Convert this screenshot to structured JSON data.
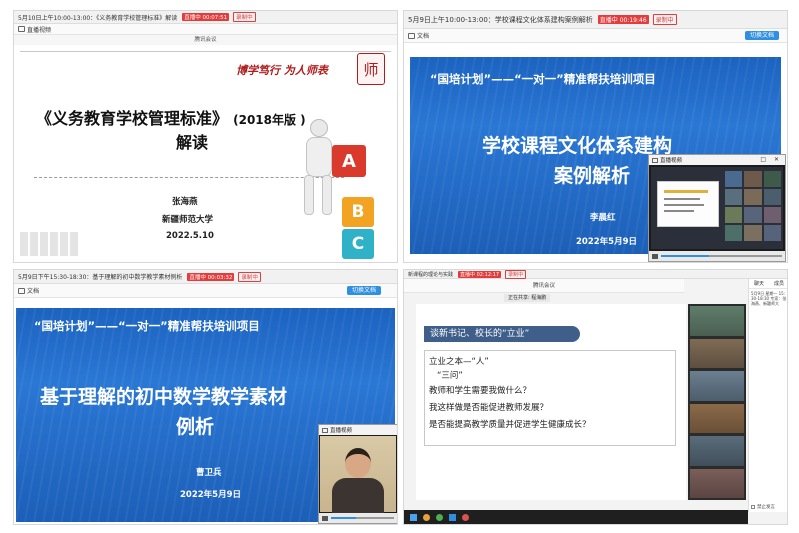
{
  "panel_tl": {
    "title": "5月10日上午10:00-13:00：《义务教育学校管理标准》解读",
    "badge_live": "直播中 00:07:51",
    "badge_rec": "录制中",
    "tab_label": "直播视频",
    "share_label": "腾讯会议",
    "motto": "博学笃行  为人师表",
    "heading": "《义务教育学校管理标准》",
    "heading_year": "(2018年版 )",
    "heading_sub": "解读",
    "speaker": "张海燕",
    "org": "新疆师范大学",
    "date": "2022.5.10",
    "cubes": [
      "A",
      "B",
      "C"
    ]
  },
  "panel_tr": {
    "title": "5月9日上午10:00-13:00：学校课程文化体系建构案例解析",
    "badge_live": "直播中 00:19:46",
    "badge_rec": "录制中",
    "doc_label": "文档",
    "switch_label": "切换文档",
    "program": "“国培计划”——“一对一”精准帮扶培训项目",
    "heading_line1": "学校课程文化体系建构",
    "heading_line2": "案例解析",
    "speaker": "李晨红",
    "date": "2022年5月9日",
    "video_label": "直播视频"
  },
  "panel_bl": {
    "title": "5月9日下午15:30-18:30：基于理解的初中数学教学素材例析",
    "badge_live": "直播中 00:03:32",
    "badge_rec": "录制中",
    "doc_label": "文档",
    "switch_label": "切换文档",
    "program": "“国培计划”——“一对一”精准帮扶培训项目",
    "heading_line1": "基于理解的初中数学教学素材",
    "heading_line2": "例析",
    "speaker": "曹卫兵",
    "date": "2022年5月9日",
    "video_label": "直播视频"
  },
  "panel_br": {
    "title": "新课程的理论与实践",
    "badge_live": "直播中 02:12:17",
    "badge_rec": "录制中",
    "share_label": "腾讯会议",
    "share_user": "正在共享: 程海鹏",
    "banner": "谈新书记、校长的“立业”",
    "lines": [
      "立业之本—“人”",
      "“三问”",
      "教师和学生需要我做什么？",
      "我这样做是否能促进教师发展？",
      "是否能提高教学质量并促进学生健康成长？"
    ],
    "chat_tabs": [
      "聊天",
      "成员"
    ],
    "chat_msg": "5月9日 星期一 15:30-18:30 专家：张海燕、新疆师大",
    "checkbox_label": "禁止发言"
  },
  "colors": {
    "slide_blue": "#1c63c0",
    "badge_red": "#e23c3c",
    "accent_blue": "#2f8fe0",
    "motto_red": "#b01c1c"
  }
}
